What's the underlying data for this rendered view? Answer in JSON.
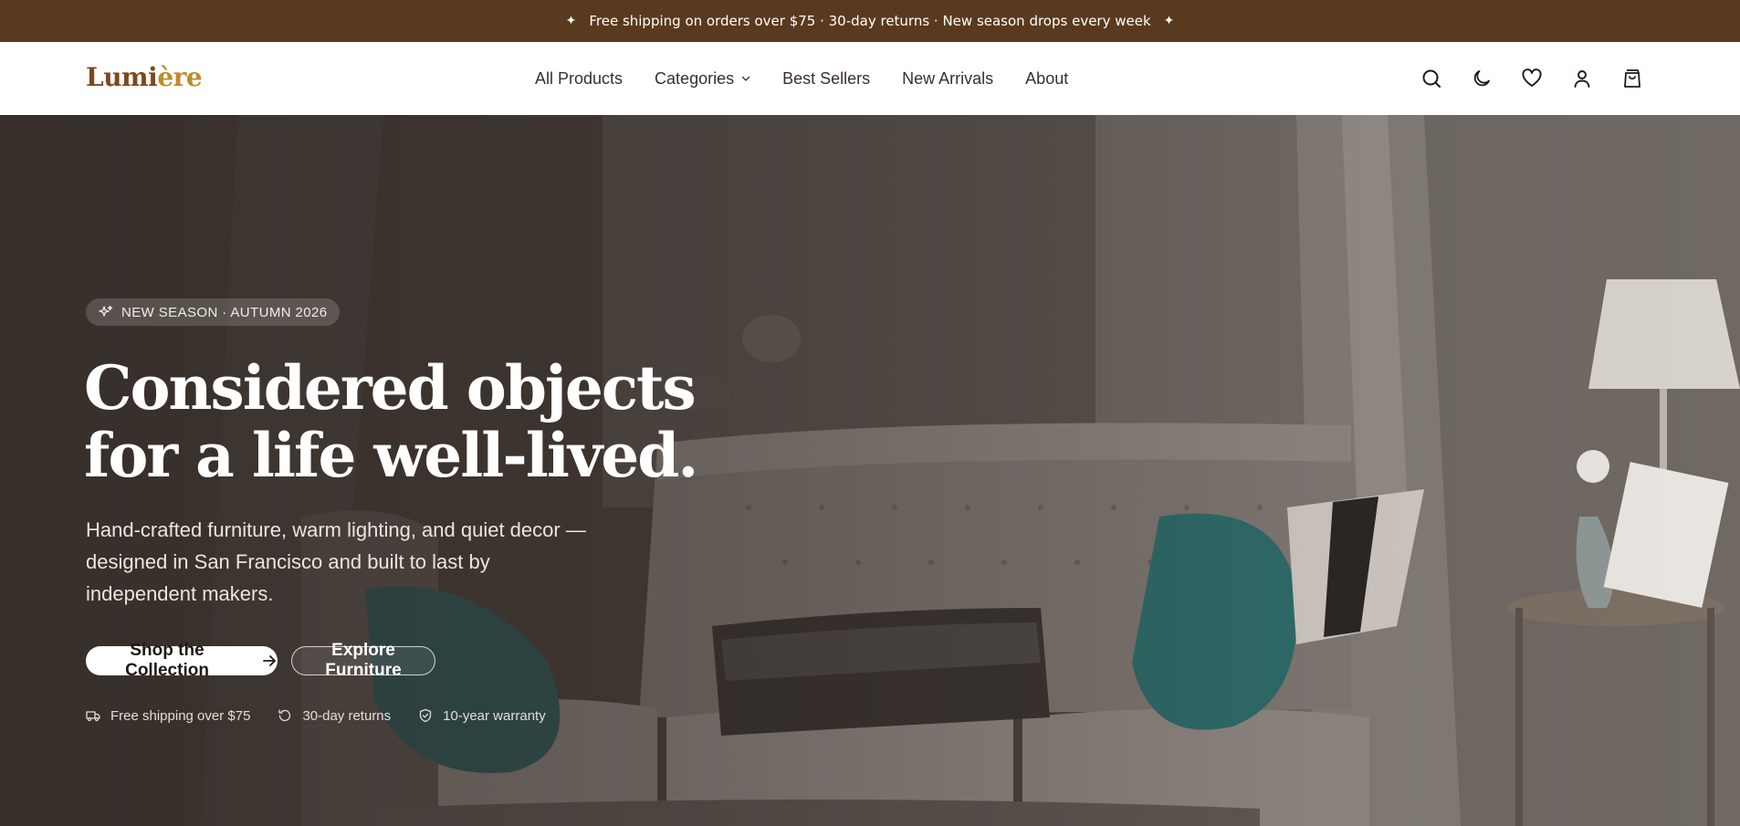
{
  "announcement": {
    "text": "Free shipping on orders over $75 · 30-day returns · New season drops every week",
    "left_icon": "sparkle-icon",
    "right_icon": "sparkle-icon"
  },
  "header": {
    "logo_main": "Lumi",
    "logo_accent": "ère",
    "nav": [
      {
        "label": "All Products"
      },
      {
        "label": "Categories",
        "has_dropdown": true
      },
      {
        "label": "Best Sellers"
      },
      {
        "label": "New Arrivals"
      },
      {
        "label": "About"
      }
    ],
    "icons": [
      "search-icon",
      "moon-icon",
      "heart-icon",
      "user-icon",
      "cart-icon"
    ]
  },
  "hero": {
    "badge": "NEW SEASON · AUTUMN 2026",
    "headline_line1": "Considered objects",
    "headline_line2": "for a life well-lived.",
    "subtitle": "Hand-crafted furniture, warm lighting, and quiet decor — designed in San Francisco and built to last by independent makers.",
    "primary_cta": "Shop the Collection",
    "secondary_cta": "Explore Furniture",
    "perks": [
      {
        "icon": "truck-icon",
        "label": "Free shipping over $75"
      },
      {
        "icon": "rotate-icon",
        "label": "30-day returns"
      },
      {
        "icon": "shield-icon",
        "label": "10-year warranty"
      }
    ]
  },
  "colors": {
    "announcement_bg": "#5a3a1e",
    "logo": "#7a4a1e",
    "logo_accent": "#c08a2e",
    "nav_text": "#3b2f2a"
  }
}
